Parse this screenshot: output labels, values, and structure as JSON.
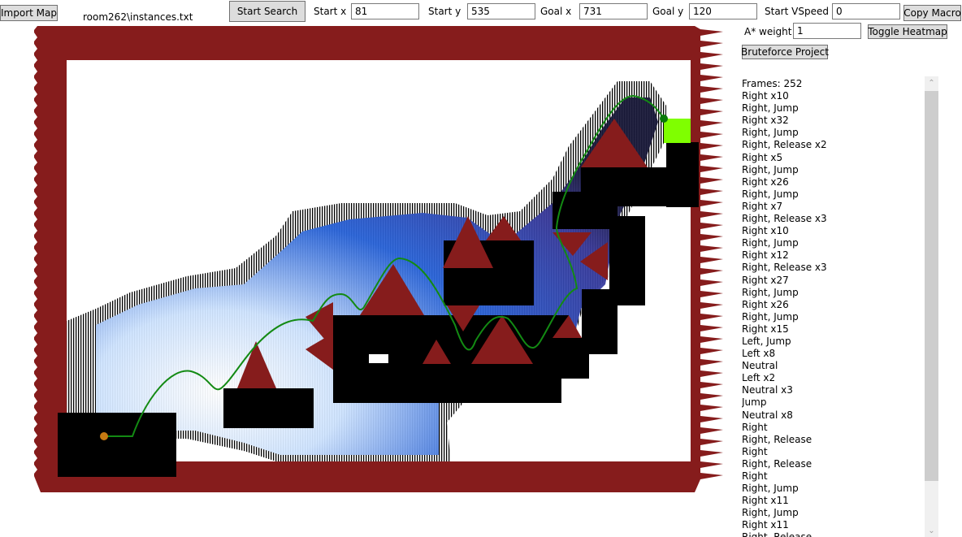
{
  "toolbar": {
    "import_map_label": "Import Map",
    "file_path": "room262\\instances.txt",
    "start_search_label": "Start Search",
    "start_x_label": "Start x",
    "start_x_value": "81",
    "start_y_label": "Start y",
    "start_y_value": "535",
    "goal_x_label": "Goal x",
    "goal_x_value": "731",
    "goal_y_label": "Goal y",
    "goal_y_value": "120",
    "start_vspeed_label": "Start VSpeed",
    "start_vspeed_value": "0",
    "copy_macro_label": "Copy Macro",
    "astar_weight_label": "A* weight",
    "astar_weight_value": "1",
    "toggle_heatmap_label": "Toggle Heatmap",
    "bruteforce_label": "Bruteforce Project"
  },
  "colors": {
    "border_wall": "#861c1c",
    "solid_block": "#000000",
    "spike": "#861c1c",
    "goal": "#7fff00",
    "path": "#138a13",
    "start_marker": "#c77a12",
    "end_marker": "#0a7a0a",
    "heatmap_cool": "#2a64d8",
    "heatmap_hot": "#ffffff"
  },
  "macro": [
    "Frames: 252",
    "Right x10",
    "Right, Jump",
    "Right x32",
    "Right, Jump",
    "Right, Release x2",
    "Right x5",
    "Right, Jump",
    "Right x26",
    "Right, Jump",
    "Right x7",
    "Right, Release x3",
    "Right x10",
    "Right, Jump",
    "Right x12",
    "Right, Release x3",
    "Right x27",
    "Right, Jump",
    "Right x26",
    "Right, Jump",
    "Right x15",
    "Left, Jump",
    "Left x8",
    "Neutral",
    "Left x2",
    "Neutral x3",
    "Jump",
    "Neutral x8",
    "Right",
    "Right, Release",
    "Right",
    "Right, Release",
    "Right",
    "Right, Jump",
    "Right x11",
    "Right, Jump",
    "Right x11",
    "Right, Release"
  ]
}
